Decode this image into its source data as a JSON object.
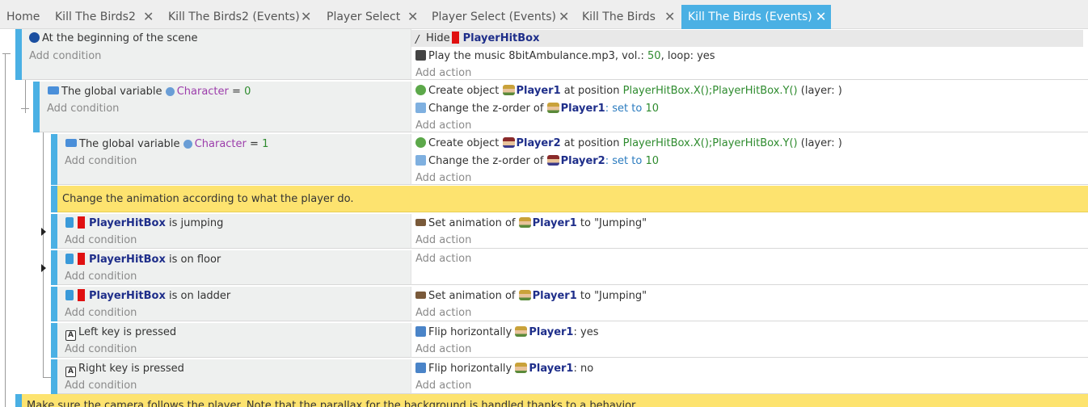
{
  "tabs": [
    {
      "label": "Home",
      "closable": false,
      "active": false
    },
    {
      "label": "Kill The Birds2",
      "closable": true,
      "active": false
    },
    {
      "label": "Kill The Birds2 (Events)",
      "closable": true,
      "active": false
    },
    {
      "label": "Player Select",
      "closable": true,
      "active": false
    },
    {
      "label": "Player Select (Events)",
      "closable": true,
      "active": false
    },
    {
      "label": "Kill The Birds",
      "closable": true,
      "active": false
    },
    {
      "label": "Kill The Birds (Events)",
      "closable": true,
      "active": true
    }
  ],
  "close_glyph": "✕",
  "add_condition": "Add condition",
  "add_action": "Add action",
  "events": {
    "e1": {
      "condition": "At the beginning of the scene",
      "a1_prefix": "Hide",
      "a1_obj": "PlayerHitBox",
      "a2_text": "Play the music 8bitAmbulance.mp3, vol.: ",
      "a2_vol": "50",
      "a2_rest": ", loop: yes"
    },
    "e2": {
      "cond_prefix": "The global variable",
      "cond_var": "Character",
      "cond_op": "=",
      "cond_val": "0",
      "a1_prefix": "Create object",
      "a1_obj": "Player1",
      "a1_mid": "at position",
      "a1_expr": "PlayerHitBox.X();PlayerHitBox.Y()",
      "a1_suffix": "(layer: )",
      "a2_prefix": "Change the z-order of",
      "a2_obj": "Player1",
      "a2_set": ": set to",
      "a2_val": "10"
    },
    "e3": {
      "cond_prefix": "The global variable",
      "cond_var": "Character",
      "cond_op": "=",
      "cond_val": "1",
      "a1_prefix": "Create object",
      "a1_obj": "Player2",
      "a1_mid": "at position",
      "a1_expr": "PlayerHitBox.X();PlayerHitBox.Y()",
      "a1_suffix": "(layer: )",
      "a2_prefix": "Change the z-order of",
      "a2_obj": "Player2",
      "a2_set": ": set to",
      "a2_val": "10"
    },
    "comment1": "Change the animation according to what the player do.",
    "e4": {
      "cond_obj": "PlayerHitBox",
      "cond_suffix": "is jumping",
      "a1_prefix": "Set animation of",
      "a1_obj": "Player1",
      "a1_suffix": "to \"Jumping\""
    },
    "e5": {
      "cond_obj": "PlayerHitBox",
      "cond_suffix": "is on floor"
    },
    "e6": {
      "cond_obj": "PlayerHitBox",
      "cond_suffix": "is on ladder",
      "a1_prefix": "Set animation of",
      "a1_obj": "Player1",
      "a1_suffix": "to \"Jumping\""
    },
    "e7": {
      "cond_key": "Left",
      "cond_suffix": "key is pressed",
      "a1_prefix": "Flip horizontally",
      "a1_obj": "Player1",
      "a1_suffix": ": yes"
    },
    "e8": {
      "cond_key": "Right",
      "cond_suffix": "key is pressed",
      "a1_prefix": "Flip horizontally",
      "a1_obj": "Player1",
      "a1_suffix": ": no"
    },
    "comment2": "Make sure the camera follows the player. Note that the parallax for the background is handled thanks to a behavior."
  }
}
